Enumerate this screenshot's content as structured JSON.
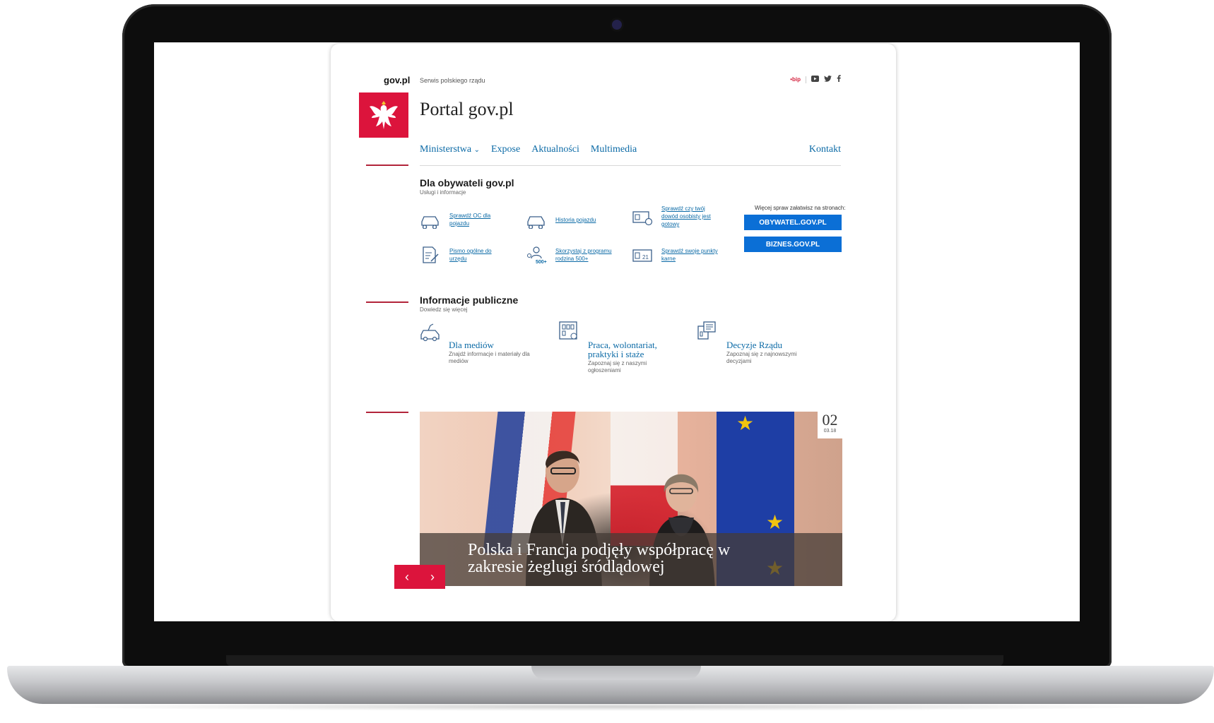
{
  "site": {
    "brand": "gov.pl",
    "tagline": "Serwis polskiego rządu",
    "title": "Portal gov.pl",
    "social": {
      "bip": "•bip"
    }
  },
  "nav": {
    "items": [
      "Ministerstwa",
      "Expose",
      "Aktualności",
      "Multimedia"
    ],
    "kontakt": "Kontakt"
  },
  "citizens": {
    "title": "Dla obywateli gov.pl",
    "subtitle": "Usługi i informacje",
    "services": [
      {
        "label": "Sprawdź OC dla pojazdu",
        "icon": "car-icon"
      },
      {
        "label": "Historia pojazdu",
        "icon": "car-history-icon"
      },
      {
        "label": "Sprawdź czy twój dowód osobisty jest gotowy",
        "icon": "id-card-icon"
      },
      {
        "label": "Pismo ogólne do urzędu",
        "icon": "document-edit-icon"
      },
      {
        "label": "Skorzystaj z programu rodzina 500+",
        "icon": "family-500-icon"
      },
      {
        "label": "Sprawdź swoje punkty karne",
        "icon": "penalty-points-icon"
      }
    ],
    "more_text": "Więcej spraw załatwisz na stronach:",
    "buttons": [
      "OBYWATEL.GOV.PL",
      "BIZNES.GOV.PL"
    ]
  },
  "public_info": {
    "title": "Informacje publiczne",
    "subtitle": "Dowiedz się więcej",
    "items": [
      {
        "title": "Dla mediów",
        "desc": "Znajdź informacje i materiały dla mediów"
      },
      {
        "title": "Praca, wolontariat, praktyki i staże",
        "desc": "Zapoznaj się z naszymi ogłoszeniami"
      },
      {
        "title": "Decyzje Rządu",
        "desc": "Zapoznaj się z najnowszymi decyzjami"
      }
    ]
  },
  "hero": {
    "day": "02",
    "month_year": "03.18",
    "caption": "Polska i Francja podjęły współpracę w zakresie żeglugi śródlądowej"
  },
  "colors": {
    "accent": "#dc143c",
    "link": "#0b6aa6",
    "button": "#0b6fd6"
  }
}
